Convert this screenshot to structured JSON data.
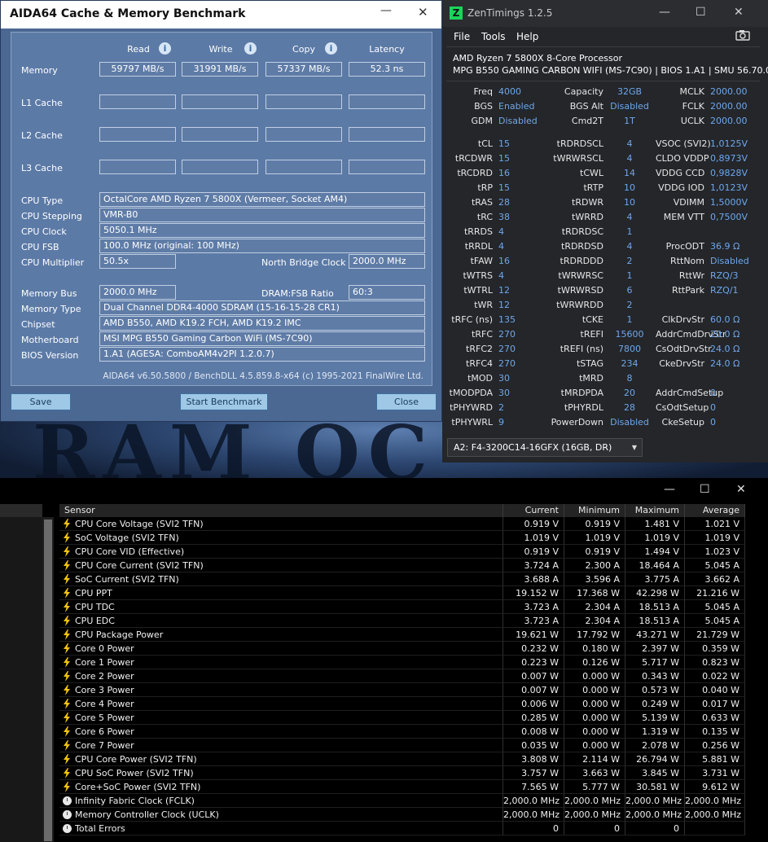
{
  "wallpaper": {
    "text": "RAM OC"
  },
  "aida": {
    "title": "AIDA64 Cache & Memory Benchmark",
    "minimize": "—",
    "close": "✕",
    "headers": {
      "read": "Read",
      "write": "Write",
      "copy": "Copy",
      "latency": "Latency"
    },
    "rows": [
      {
        "label": "Memory",
        "read": "59797 MB/s",
        "write": "31991 MB/s",
        "copy": "57337 MB/s",
        "latency": "52.3 ns"
      },
      {
        "label": "L1 Cache",
        "read": "",
        "write": "",
        "copy": "",
        "latency": ""
      },
      {
        "label": "L2 Cache",
        "read": "",
        "write": "",
        "copy": "",
        "latency": ""
      },
      {
        "label": "L3 Cache",
        "read": "",
        "write": "",
        "copy": "",
        "latency": ""
      }
    ],
    "info": {
      "cpu_type_label": "CPU Type",
      "cpu_type": "OctalCore AMD Ryzen 7 5800X  (Vermeer, Socket AM4)",
      "cpu_stepping_label": "CPU Stepping",
      "cpu_stepping": "VMR-B0",
      "cpu_clock_label": "CPU Clock",
      "cpu_clock": "5050.1 MHz",
      "cpu_fsb_label": "CPU FSB",
      "cpu_fsb": "100.0 MHz  (original: 100 MHz)",
      "cpu_mult_label": "CPU Multiplier",
      "cpu_mult": "50.5x",
      "nb_clock_label": "North Bridge Clock",
      "nb_clock": "2000.0 MHz",
      "mem_bus_label": "Memory Bus",
      "mem_bus": "2000.0 MHz",
      "dram_fsb_label": "DRAM:FSB Ratio",
      "dram_fsb": "60:3",
      "mem_type_label": "Memory Type",
      "mem_type": "Dual Channel DDR4-4000 SDRAM  (15-16-15-28 CR1)",
      "chipset_label": "Chipset",
      "chipset": "AMD B550, AMD K19.2 FCH, AMD K19.2 IMC",
      "mobo_label": "Motherboard",
      "mobo": "MSI MPG B550 Gaming Carbon WiFi (MS-7C90)",
      "bios_label": "BIOS Version",
      "bios": "1.A1  (AGESA: ComboAM4v2PI 1.2.0.7)"
    },
    "footer": "AIDA64 v6.50.5800 / BenchDLL 4.5.859.8-x64  (c) 1995-2021 FinalWire Ltd.",
    "save_label": "Save",
    "start_label": "Start Benchmark",
    "close_label": "Close"
  },
  "zen": {
    "title": "ZenTimings 1.2.5",
    "logo": "Z",
    "minimize": "—",
    "maximize": "☐",
    "close": "✕",
    "menu": {
      "file": "File",
      "tools": "Tools",
      "help": "Help"
    },
    "cpu": "AMD Ryzen 7 5800X 8-Core Processor",
    "board": "MPG B550 GAMING CARBON WIFI (MS-7C90) | BIOS 1.A1 | SMU 56.70.0",
    "top": [
      [
        "Freq",
        "4000",
        "Capacity",
        "32GB",
        "MCLK",
        "2000.00"
      ],
      [
        "BGS",
        "Enabled",
        "BGS Alt",
        "Disabled",
        "FCLK",
        "2000.00"
      ],
      [
        "GDM",
        "Disabled",
        "Cmd2T",
        "1T",
        "UCLK",
        "2000.00"
      ]
    ],
    "timings": [
      [
        "tCL",
        "15",
        "tRDRDSCL",
        "4",
        "VSOC (SVI2)",
        "1,0125V"
      ],
      [
        "tRCDWR",
        "15",
        "tWRWRSCL",
        "4",
        "CLDO VDDP",
        "0,8973V"
      ],
      [
        "tRCDRD",
        "16",
        "tCWL",
        "14",
        "VDDG CCD",
        "0,9828V"
      ],
      [
        "tRP",
        "15",
        "tRTP",
        "10",
        "VDDG IOD",
        "1,0123V"
      ],
      [
        "tRAS",
        "28",
        "tRDWR",
        "10",
        "VDIMM",
        "1,5000V"
      ],
      [
        "tRC",
        "38",
        "tWRRD",
        "4",
        "MEM VTT",
        "0,7500V"
      ],
      [
        "tRRDS",
        "4",
        "tRDRDSC",
        "1",
        "",
        ""
      ],
      [
        "tRRDL",
        "4",
        "tRDRDSD",
        "4",
        "ProcODT",
        "36.9 Ω"
      ],
      [
        "tFAW",
        "16",
        "tRDRDDD",
        "2",
        "RttNom",
        "Disabled"
      ],
      [
        "tWTRS",
        "4",
        "tWRWRSC",
        "1",
        "RttWr",
        "RZQ/3"
      ],
      [
        "tWTRL",
        "12",
        "tWRWRSD",
        "6",
        "RttPark",
        "RZQ/1"
      ],
      [
        "tWR",
        "12",
        "tWRWRDD",
        "2",
        "",
        ""
      ],
      [
        "tRFC (ns)",
        "135",
        "tCKE",
        "1",
        "ClkDrvStr",
        "60.0 Ω"
      ],
      [
        "tRFC",
        "270",
        "tREFI",
        "15600",
        "AddrCmdDrvStr",
        "20.0 Ω"
      ],
      [
        "tRFC2",
        "270",
        "tREFI (ns)",
        "7800",
        "CsOdtDrvStr",
        "24.0 Ω"
      ],
      [
        "tRFC4",
        "270",
        "tSTAG",
        "234",
        "CkeDrvStr",
        "24.0 Ω"
      ],
      [
        "tMOD",
        "30",
        "tMRD",
        "8",
        "",
        ""
      ],
      [
        "tMODPDA",
        "30",
        "tMRDPDA",
        "20",
        "AddrCmdSetup",
        "0"
      ],
      [
        "tPHYWRD",
        "2",
        "tPHYRDL",
        "28",
        "CsOdtSetup",
        "0"
      ],
      [
        "tPHYWRL",
        "9",
        "PowerDown",
        "Disabled",
        "CkeSetup",
        "0"
      ]
    ],
    "module": "A2: F4-3200C14-16GFX (16GB, DR)"
  },
  "hw": {
    "minimize": "—",
    "maximize": "☐",
    "close": "✕",
    "headers": {
      "sensor": "Sensor",
      "current": "Current",
      "minimum": "Minimum",
      "maximum": "Maximum",
      "average": "Average"
    },
    "rows": [
      {
        "icon": "bolt",
        "name": "CPU Core Voltage (SVI2 TFN)",
        "cur": "0.919 V",
        "min": "0.919 V",
        "max": "1.481 V",
        "avg": "1.021 V"
      },
      {
        "icon": "bolt",
        "name": "SoC Voltage (SVI2 TFN)",
        "cur": "1.019 V",
        "min": "1.019 V",
        "max": "1.019 V",
        "avg": "1.019 V"
      },
      {
        "icon": "bolt",
        "name": "CPU Core VID (Effective)",
        "cur": "0.919 V",
        "min": "0.919 V",
        "max": "1.494 V",
        "avg": "1.023 V"
      },
      {
        "icon": "bolt",
        "name": "CPU Core Current (SVI2 TFN)",
        "cur": "3.724 A",
        "min": "2.300 A",
        "max": "18.464 A",
        "avg": "5.045 A"
      },
      {
        "icon": "bolt",
        "name": "SoC Current (SVI2 TFN)",
        "cur": "3.688 A",
        "min": "3.596 A",
        "max": "3.775 A",
        "avg": "3.662 A"
      },
      {
        "icon": "bolt",
        "name": "CPU PPT",
        "cur": "19.152 W",
        "min": "17.368 W",
        "max": "42.298 W",
        "avg": "21.216 W"
      },
      {
        "icon": "bolt",
        "name": "CPU TDC",
        "cur": "3.723 A",
        "min": "2.304 A",
        "max": "18.513 A",
        "avg": "5.045 A"
      },
      {
        "icon": "bolt",
        "name": "CPU EDC",
        "cur": "3.723 A",
        "min": "2.304 A",
        "max": "18.513 A",
        "avg": "5.045 A"
      },
      {
        "icon": "bolt",
        "name": "CPU Package Power",
        "cur": "19.621 W",
        "min": "17.792 W",
        "max": "43.271 W",
        "avg": "21.729 W"
      },
      {
        "icon": "bolt",
        "name": "Core 0 Power",
        "cur": "0.232 W",
        "min": "0.180 W",
        "max": "2.397 W",
        "avg": "0.359 W"
      },
      {
        "icon": "bolt",
        "name": "Core 1 Power",
        "cur": "0.223 W",
        "min": "0.126 W",
        "max": "5.717 W",
        "avg": "0.823 W"
      },
      {
        "icon": "bolt",
        "name": "Core 2 Power",
        "cur": "0.007 W",
        "min": "0.000 W",
        "max": "0.343 W",
        "avg": "0.022 W"
      },
      {
        "icon": "bolt",
        "name": "Core 3 Power",
        "cur": "0.007 W",
        "min": "0.000 W",
        "max": "0.573 W",
        "avg": "0.040 W"
      },
      {
        "icon": "bolt",
        "name": "Core 4 Power",
        "cur": "0.006 W",
        "min": "0.000 W",
        "max": "0.249 W",
        "avg": "0.017 W"
      },
      {
        "icon": "bolt",
        "name": "Core 5 Power",
        "cur": "0.285 W",
        "min": "0.000 W",
        "max": "5.139 W",
        "avg": "0.633 W"
      },
      {
        "icon": "bolt",
        "name": "Core 6 Power",
        "cur": "0.008 W",
        "min": "0.000 W",
        "max": "1.319 W",
        "avg": "0.135 W"
      },
      {
        "icon": "bolt",
        "name": "Core 7 Power",
        "cur": "0.035 W",
        "min": "0.000 W",
        "max": "2.078 W",
        "avg": "0.256 W"
      },
      {
        "icon": "bolt",
        "name": "CPU Core Power (SVI2 TFN)",
        "cur": "3.808 W",
        "min": "2.114 W",
        "max": "26.794 W",
        "avg": "5.881 W"
      },
      {
        "icon": "bolt",
        "name": "CPU SoC Power (SVI2 TFN)",
        "cur": "3.757 W",
        "min": "3.663 W",
        "max": "3.845 W",
        "avg": "3.731 W"
      },
      {
        "icon": "bolt",
        "name": "Core+SoC Power (SVI2 TFN)",
        "cur": "7.565 W",
        "min": "5.777 W",
        "max": "30.581 W",
        "avg": "9.612 W"
      },
      {
        "icon": "clock",
        "name": "Infinity Fabric Clock (FCLK)",
        "cur": "2,000.0 MHz",
        "min": "2,000.0 MHz",
        "max": "2,000.0 MHz",
        "avg": "2,000.0 MHz"
      },
      {
        "icon": "clock",
        "name": "Memory Controller Clock (UCLK)",
        "cur": "2,000.0 MHz",
        "min": "2,000.0 MHz",
        "max": "2,000.0 MHz",
        "avg": "2,000.0 MHz"
      },
      {
        "icon": "clock",
        "name": "Total Errors",
        "cur": "0",
        "min": "0",
        "max": "0",
        "avg": ""
      }
    ]
  }
}
